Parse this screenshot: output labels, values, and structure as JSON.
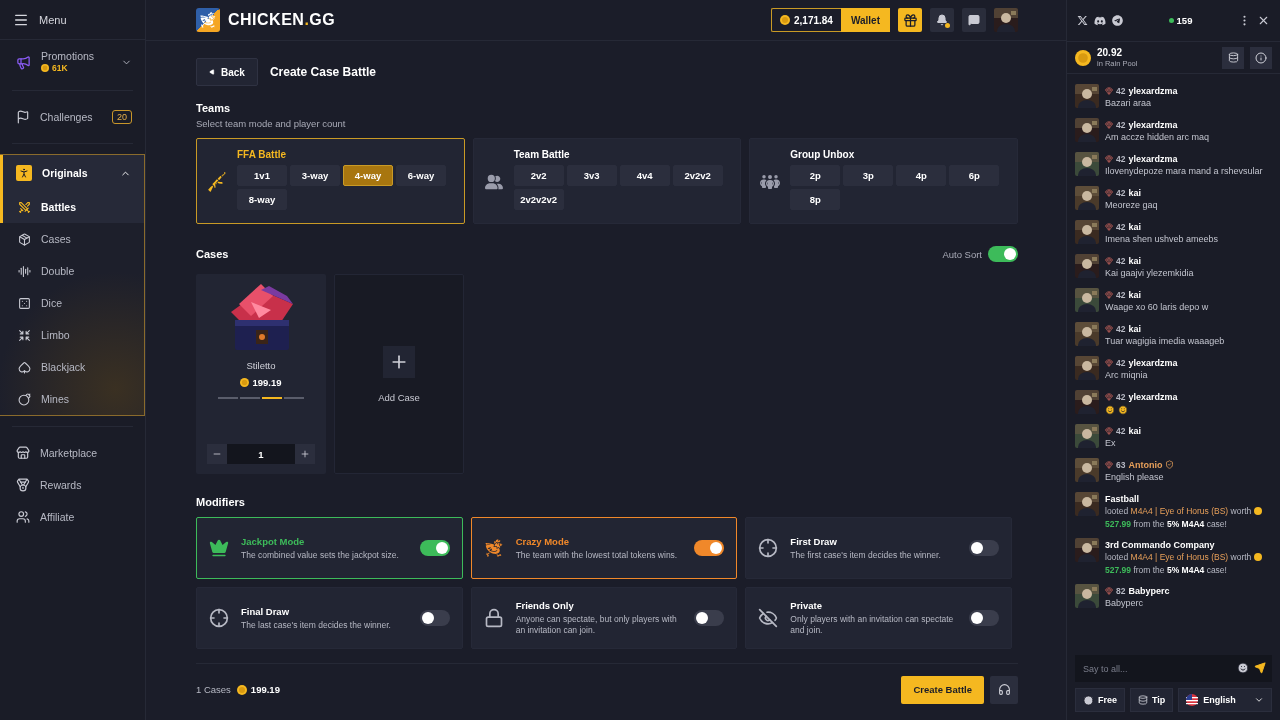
{
  "sidebar": {
    "menu_label": "Menu",
    "items": [
      {
        "label": "Promotions",
        "value": "61K",
        "selected": false
      },
      {
        "label": "Challenges",
        "badge": "20",
        "selected": false
      },
      {
        "label": "Originals",
        "selected": true,
        "expanded": true,
        "children": [
          {
            "label": "Battles",
            "selected": true
          },
          {
            "label": "Cases",
            "selected": false
          },
          {
            "label": "Double",
            "selected": false
          },
          {
            "label": "Dice",
            "selected": false
          },
          {
            "label": "Limbo",
            "selected": false
          },
          {
            "label": "Blackjack",
            "selected": false
          },
          {
            "label": "Mines",
            "selected": false
          }
        ]
      },
      {
        "label": "Marketplace",
        "selected": false
      },
      {
        "label": "Rewards",
        "selected": false
      },
      {
        "label": "Affiliate",
        "selected": false
      }
    ]
  },
  "header": {
    "brand": {
      "name": "CHICKEN",
      "dot": ".",
      "suffix": "GG"
    },
    "balance": "2,171.84",
    "wallet_label": "Wallet",
    "unread_notifications": true
  },
  "page": {
    "back_label": "Back",
    "title": "Create Case Battle"
  },
  "teams": {
    "title": "Teams",
    "subtitle": "Select team mode and player count",
    "modes": [
      {
        "kind": "ffa",
        "label": "FFA Battle",
        "selected": true,
        "options": [
          {
            "label": "1v1",
            "selected": false
          },
          {
            "label": "3-way",
            "selected": false
          },
          {
            "label": "4-way",
            "selected": true
          },
          {
            "label": "6-way",
            "selected": false
          },
          {
            "label": "8-way",
            "selected": false
          }
        ]
      },
      {
        "kind": "team",
        "label": "Team Battle",
        "selected": false,
        "options": [
          {
            "label": "2v2",
            "selected": false
          },
          {
            "label": "3v3",
            "selected": false
          },
          {
            "label": "4v4",
            "selected": false
          },
          {
            "label": "2v2v2",
            "selected": false
          },
          {
            "label": "2v2v2v2",
            "selected": false
          }
        ]
      },
      {
        "kind": "group",
        "label": "Group Unbox",
        "selected": false,
        "options": [
          {
            "label": "2p",
            "selected": false
          },
          {
            "label": "3p",
            "selected": false
          },
          {
            "label": "4p",
            "selected": false
          },
          {
            "label": "6p",
            "selected": false
          },
          {
            "label": "8p",
            "selected": false
          }
        ]
      }
    ]
  },
  "cases": {
    "title": "Cases",
    "auto_sort": {
      "label": "Auto Sort",
      "on": true
    },
    "items": [
      {
        "name": "Stiletto",
        "price": "199.19",
        "quantity": "1"
      }
    ],
    "add_label": "Add Case"
  },
  "modifiers": {
    "title": "Modifiers",
    "items": [
      {
        "kind": "jackpot",
        "title": "Jackpot Mode",
        "description": "The combined value sets the jackpot size.",
        "on": true,
        "color": "#3dbb5a"
      },
      {
        "kind": "crazy",
        "title": "Crazy Mode",
        "description": "The team with the lowest total tokens wins.",
        "on": true,
        "color": "#f0882a"
      },
      {
        "kind": "first_draw",
        "title": "First Draw",
        "description": "The first case's item decides the winner.",
        "on": false
      },
      {
        "kind": "final_draw",
        "title": "Final Draw",
        "description": "The last case's item decides the winner.",
        "on": false
      },
      {
        "kind": "friends",
        "title": "Friends Only",
        "description": "Anyone can spectate, but only players with an invitation can join.",
        "on": false
      },
      {
        "kind": "private",
        "title": "Private",
        "description": "Only players with an invitation can spectate and join.",
        "on": false
      }
    ]
  },
  "footer": {
    "count": "1 Cases",
    "total": "199.19",
    "create_label": "Create Battle"
  },
  "chat": {
    "online": "159",
    "rain": {
      "amount": "20.92",
      "label": "in Rain Pool"
    },
    "messages": [
      {
        "kind": "text",
        "name": "ylexardzma",
        "rank": "42",
        "color": "#ffffff",
        "text": "Bazari araa"
      },
      {
        "kind": "text",
        "name": "ylexardzma",
        "rank": "42",
        "color": "#ffffff",
        "text": "Am accze hidden arc maq"
      },
      {
        "kind": "text",
        "name": "ylexardzma",
        "rank": "42",
        "color": "#ffffff",
        "text": "Ilovenydepoze mara mand a rshevsular"
      },
      {
        "kind": "text",
        "name": "kai",
        "rank": "42",
        "color": "#ffffff",
        "text": "Meoreze gaq"
      },
      {
        "kind": "text",
        "name": "kai",
        "rank": "42",
        "color": "#ffffff",
        "text": "Imena shen ushveb ameebs"
      },
      {
        "kind": "text",
        "name": "kai",
        "rank": "42",
        "color": "#ffffff",
        "text": "Kai gaajvi ylezemkidia"
      },
      {
        "kind": "text",
        "name": "kai",
        "rank": "42",
        "color": "#ffffff",
        "text": "Waage xo 60 laris depo w"
      },
      {
        "kind": "text",
        "name": "kai",
        "rank": "42",
        "color": "#ffffff",
        "text": "Tuar wagigia imedia waaageb"
      },
      {
        "kind": "text",
        "name": "ylexardzma",
        "rank": "42",
        "color": "#ffffff",
        "text": "Arc miqnia"
      },
      {
        "kind": "emoji",
        "name": "ylexardzma",
        "rank": "42",
        "color": "#ffffff"
      },
      {
        "kind": "text",
        "name": "kai",
        "rank": "42",
        "color": "#ffffff",
        "text": "Ex"
      },
      {
        "kind": "text",
        "name": "Antonio",
        "rank": "63",
        "color": "#e8a05a",
        "staff": true,
        "text": "English please"
      },
      {
        "kind": "loot",
        "name": "Fastball",
        "parts": [
          {
            "kind": "plain",
            "text": "looted"
          },
          {
            "kind": "item",
            "text": "M4A4 | Eye of Horus (BS)"
          },
          {
            "kind": "plain",
            "text": "worth"
          },
          {
            "kind": "amount",
            "text": "527.99"
          },
          {
            "kind": "plain",
            "text": "from the"
          },
          {
            "kind": "bold",
            "text": "5% M4A4"
          },
          {
            "kind": "plain",
            "text": "case!"
          }
        ]
      },
      {
        "kind": "loot",
        "name": "3rd Commando Company",
        "parts": [
          {
            "kind": "plain",
            "text": "looted"
          },
          {
            "kind": "item",
            "text": "M4A4 | Eye of Horus (BS)"
          },
          {
            "kind": "plain",
            "text": "worth"
          },
          {
            "kind": "amount",
            "text": "527.99"
          },
          {
            "kind": "plain",
            "text": "from the"
          },
          {
            "kind": "bold",
            "text": "5% M4A4"
          },
          {
            "kind": "plain",
            "text": "case!"
          }
        ]
      },
      {
        "kind": "text",
        "name": "Babyperc",
        "rank": "82",
        "color": "#ffffff",
        "text": "Babyperc"
      }
    ],
    "input": {
      "placeholder": "Say to all..."
    },
    "buttons": [
      {
        "kind": "free",
        "label": "Free"
      },
      {
        "kind": "tip",
        "label": "Tip"
      }
    ],
    "language": "English"
  }
}
